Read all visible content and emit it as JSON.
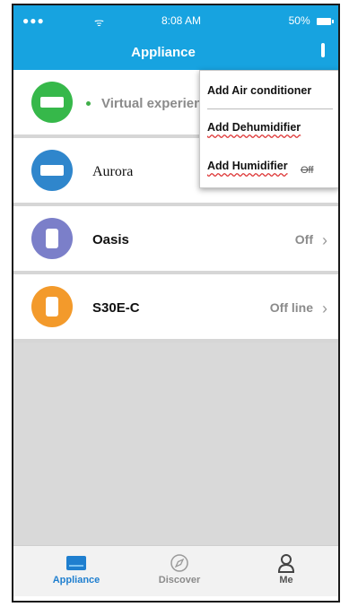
{
  "status_bar": {
    "signal": "●●●",
    "wifi": "ᯤ",
    "time": "8:08 AM",
    "battery": "50%"
  },
  "header": {
    "title": "Appliance"
  },
  "devices": [
    {
      "name": "Virtual experience",
      "status": "",
      "icon": "air-conditioner-icon",
      "color": "#36b84a"
    },
    {
      "name": "Aurora",
      "status": "",
      "icon": "air-conditioner-icon",
      "color": "#2f86cc"
    },
    {
      "name": "Oasis",
      "status": "Off",
      "icon": "humidifier-icon",
      "color": "#7b7fc9"
    },
    {
      "name": "S30E-C",
      "status": "Off line",
      "icon": "dehumidifier-icon",
      "color": "#f39a2b"
    }
  ],
  "menu": {
    "items": [
      "Add Air conditioner",
      "Add Dehumidifier",
      "Add Humidifier"
    ],
    "overlap_text": "Off"
  },
  "tabs": [
    {
      "label": "Appliance",
      "icon": "appliance-icon",
      "active": true
    },
    {
      "label": "Discover",
      "icon": "compass-icon",
      "active": false
    },
    {
      "label": "Me",
      "icon": "person-icon",
      "active": false
    }
  ],
  "colors": {
    "accent": "#17a3e0",
    "active_tab": "#1f7fcf"
  }
}
